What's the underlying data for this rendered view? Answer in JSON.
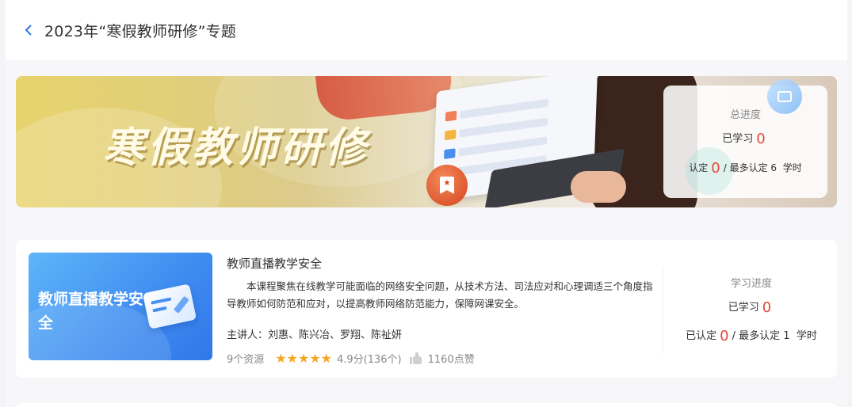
{
  "header": {
    "title": "2023年“寒假教师研修”专题"
  },
  "banner": {
    "title": "寒假教师研修",
    "progress": {
      "label": "总进度",
      "learned_label": "已学习",
      "learned_value": "0",
      "certified_label": "认定",
      "certified_value": "0",
      "max_text": "/ 最多认定 6",
      "unit": "学时"
    }
  },
  "course": {
    "cover_title": "教师直播教学安全",
    "name": "教师直播教学安全",
    "description": "本课程聚焦在线教学可能面临的网络安全问题，从技术方法、司法应对和心理调适三个角度指导教师如何防范和应对，以提高教师网络防范能力，保障网课安全。",
    "lecturer": "主讲人：刘惠、陈兴冶、罗翔、陈祉妍",
    "resources": "9个资源",
    "rating": 4.9,
    "rating_stars": 5,
    "rating_text": "4.9分(136个)",
    "likes": "1160点赞",
    "progress": {
      "label": "学习进度",
      "learned_label": "已学习",
      "learned_value": "0",
      "certified_label": "已认定",
      "certified_value": "0",
      "max_text": "/ 最多认定 1",
      "unit": "学时"
    }
  },
  "colors": {
    "accent_red": "#e5483a",
    "star": "#f5a623",
    "link_blue": "#2f78e8"
  },
  "icons": {
    "back": "chevron-left-icon",
    "badge": "bookmark-star-icon",
    "chat": "chat-bubble-icon",
    "like": "thumb-up-icon",
    "star": "star-icon"
  }
}
